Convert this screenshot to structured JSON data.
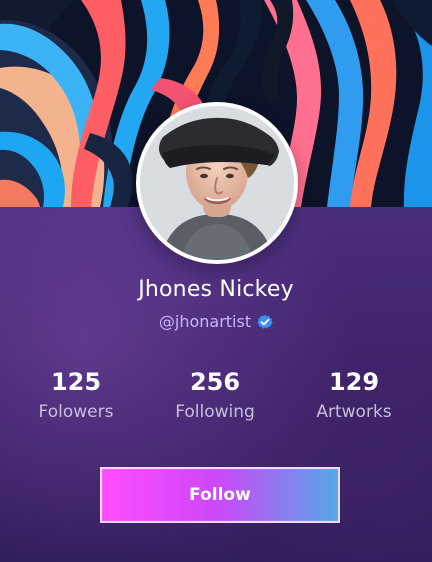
{
  "profile": {
    "name": "Jhones Nickey",
    "handle": "@jhonartist"
  },
  "stats": [
    {
      "value": "125",
      "label": "Folowers"
    },
    {
      "value": "256",
      "label": "Following"
    },
    {
      "value": "129",
      "label": "Artworks"
    }
  ],
  "actions": {
    "follow_label": "Follow"
  },
  "colors": {
    "name_text": "#ffffff",
    "handle_text": "#ccb3ff",
    "stat_label_text": "#c7bfdc",
    "button_start": "#ff4cff",
    "button_end": "#55a7e7",
    "verified_badge": "#3d8ff0"
  },
  "icons": {
    "verified": "verified-icon"
  }
}
